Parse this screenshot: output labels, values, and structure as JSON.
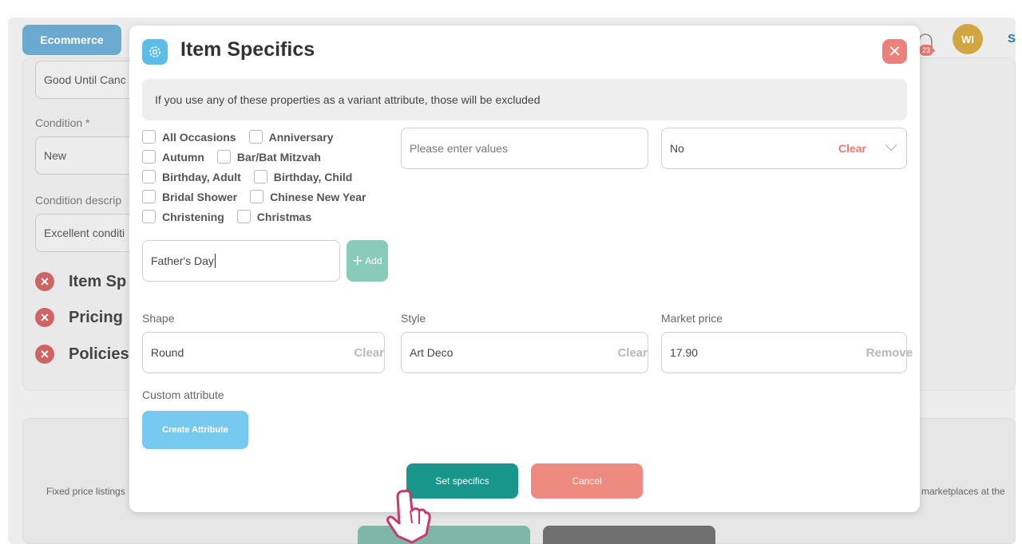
{
  "background": {
    "tab_label": "Ecommerce",
    "avatar_initials": "WI",
    "notification_count": "23",
    "cut_text": "S",
    "fields": {
      "duration_value": "Good Until Canc",
      "condition_label": "Condition *",
      "condition_value": "New",
      "condition_desc_label": "Condition descrip",
      "condition_desc_value": "Excellent conditi"
    },
    "sections": [
      "Item Sp",
      "Pricing",
      "Policies"
    ],
    "footer_left": "Fixed price listings",
    "footer_right": "marketplaces at the"
  },
  "modal": {
    "title": "Item Specifics",
    "notice": "If you use any of these properties as a variant attribute, those will be excluded",
    "occasions": [
      [
        "All Occasions",
        "Anniversary"
      ],
      [
        "Autumn",
        "Bar/Bat Mitzvah"
      ],
      [
        "Birthday, Adult",
        "Birthday, Child"
      ],
      [
        "Bridal Shower",
        "Chinese New Year"
      ],
      [
        "Christening",
        "Christmas"
      ]
    ],
    "values_placeholder": "Please enter values",
    "select_value": "No",
    "select_clear": "Clear",
    "custom_occasion_value": "Father's Day",
    "add_label": "Add",
    "shape": {
      "label": "Shape",
      "value": "Round",
      "clear": "Clear"
    },
    "style": {
      "label": "Style",
      "value": "Art Deco",
      "clear": "Clear"
    },
    "market_price": {
      "label": "Market price",
      "value": "17.90",
      "remove": "Remove"
    },
    "custom_attribute_label": "Custom attribute",
    "create_attribute_label": "Create Attribute",
    "set_specifics_label": "Set specifics",
    "cancel_label": "Cancel"
  },
  "colors": {
    "primary_teal": "#18968c",
    "cancel_red": "#ef8a80",
    "accent_blue": "#76c9ef",
    "close_red": "#ec807a"
  }
}
